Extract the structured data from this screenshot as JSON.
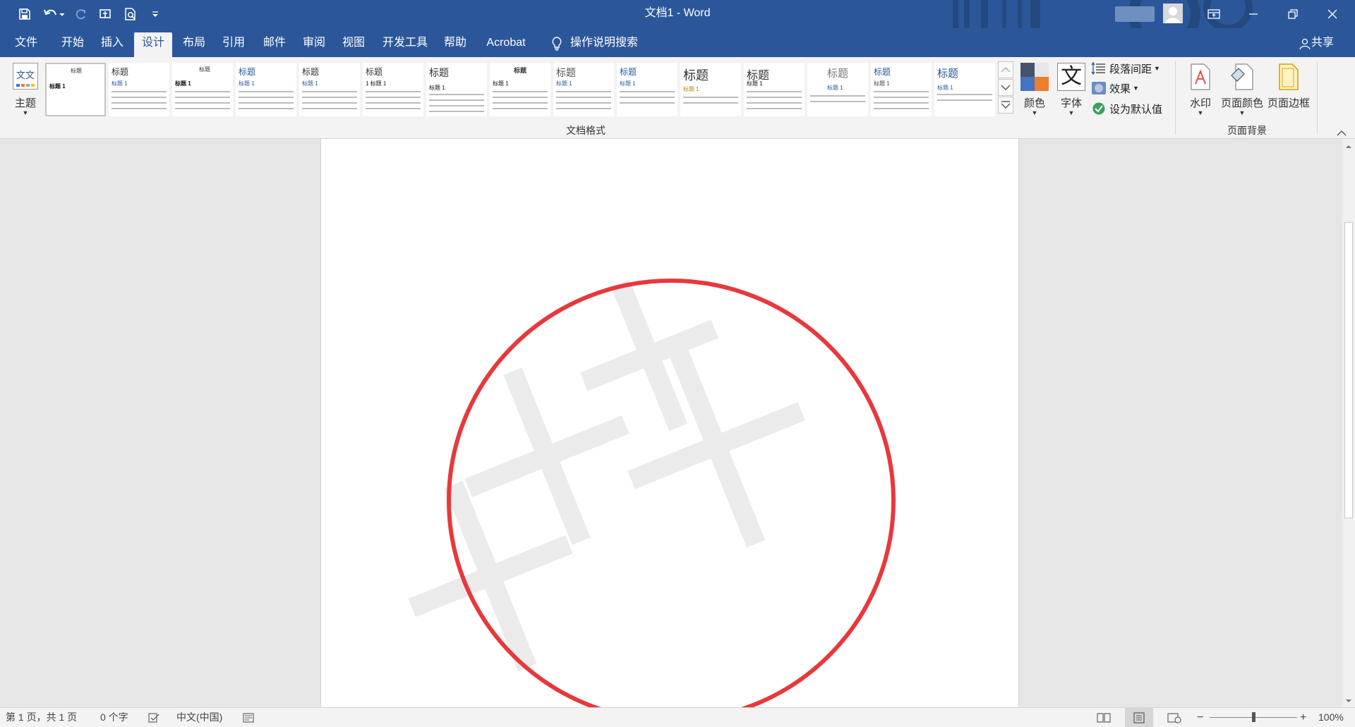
{
  "window": {
    "title": "文档1  -  Word"
  },
  "tabs": [
    {
      "label": "文件"
    },
    {
      "label": "开始"
    },
    {
      "label": "插入"
    },
    {
      "label": "设计"
    },
    {
      "label": "布局"
    },
    {
      "label": "引用"
    },
    {
      "label": "邮件"
    },
    {
      "label": "审阅"
    },
    {
      "label": "视图"
    },
    {
      "label": "开发工具"
    },
    {
      "label": "帮助"
    },
    {
      "label": "Acrobat"
    }
  ],
  "active_tab": "设计",
  "tell_me": {
    "label": "操作说明搜索"
  },
  "share": {
    "label": "共享"
  },
  "ribbon": {
    "theme_label": "主题",
    "theme_icon_text": "文文",
    "gallery_group_label": "文档格式",
    "style_thumbs": [
      {
        "title": "标题",
        "h1": "标题 1"
      },
      {
        "title": "标题",
        "h1": "标题 1"
      },
      {
        "title": "标题",
        "h1": "标题 1"
      },
      {
        "title": "标题",
        "h1": "标题 1"
      },
      {
        "title": "标题",
        "h1": "标题 1"
      },
      {
        "title": "标题",
        "h1": "1 标题 1"
      },
      {
        "title": "标题",
        "h1": "标题 1"
      },
      {
        "title": "标题",
        "h1": "标题 1"
      },
      {
        "title": "标题",
        "h1": "标题 1"
      },
      {
        "title": "标题",
        "h1": "标题 1"
      },
      {
        "title": "标题",
        "h1": "标题 1"
      },
      {
        "title": "标题",
        "h1": "标题 1"
      },
      {
        "title": "标题",
        "h1": "标题 1"
      },
      {
        "title": "标题",
        "h1": "标题 1"
      },
      {
        "title": "标题",
        "h1": "标题 1"
      }
    ],
    "colors_label": "颜色",
    "fonts_label": "字体",
    "fonts_icon_text": "文",
    "paragraph_spacing_label": "段落间距",
    "effects_label": "效果",
    "set_default_label": "设为默认值",
    "watermark_label": "水印",
    "page_color_label": "页面颜色",
    "page_borders_label": "页面边框",
    "page_background_group_label": "页面背景"
  },
  "statusbar": {
    "page_info": "第 1 页，共 1 页",
    "word_count": "0 个字",
    "language": "中文(中国)",
    "zoom": "100%"
  },
  "colors": {
    "word_blue": "#2b579a",
    "highlight_red": "#e8383d",
    "watermark_gray": "#ebebeb"
  }
}
